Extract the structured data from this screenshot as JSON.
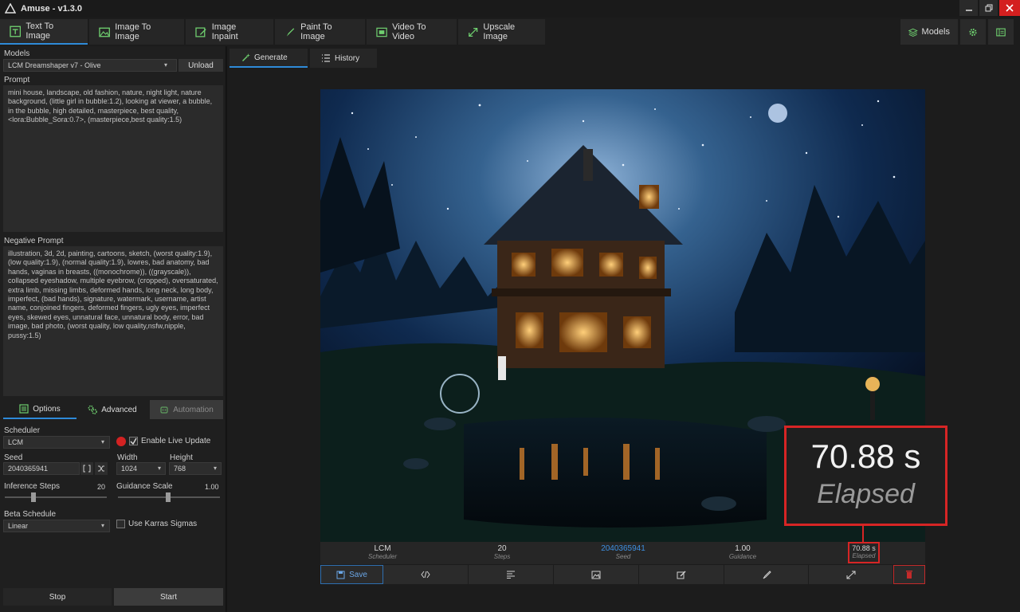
{
  "app": {
    "title": "Amuse - v1.3.0"
  },
  "tabs": [
    {
      "label": "Text To Image",
      "icon": "text-icon",
      "active": true
    },
    {
      "label": "Image To Image",
      "icon": "image-icon"
    },
    {
      "label": "Image Inpaint",
      "icon": "pencil-icon"
    },
    {
      "label": "Paint To Image",
      "icon": "brush-icon"
    },
    {
      "label": "Video To Video",
      "icon": "video-icon"
    },
    {
      "label": "Upscale Image",
      "icon": "expand-icon"
    }
  ],
  "right_tabs": {
    "models_label": "Models"
  },
  "left": {
    "models_label": "Models",
    "model_value": "LCM Dreamshaper v7 - Olive",
    "unload_label": "Unload",
    "prompt_label": "Prompt",
    "prompt_text": "mini house, landscape, old fashion, nature, night light, nature background, (little girl in bubble:1.2), looking at viewer, a bubble, in the bubble, high detailed, masterpiece, best quality, <lora:Bubble_Sora:0.7>, (masterpiece,best quality:1.5)",
    "negative_label": "Negative Prompt",
    "negative_text": "illustration, 3d, 2d, painting, cartoons, sketch, (worst quality:1.9), (low quality:1.9), (normal quality:1.9), lowres, bad anatomy, bad hands, vaginas in breasts, ((monochrome)), ((grayscale)), collapsed eyeshadow, multiple eyebrow, (cropped), oversaturated, extra limb, missing limbs, deformed hands, long neck, long body, imperfect, (bad hands), signature, watermark, username, artist name, conjoined fingers, deformed fingers, ugly eyes, imperfect eyes, skewed eyes, unnatural face, unnatural body, error, bad image, bad photo, (worst quality, low quality,nsfw,nipple, pussy:1.5)",
    "subtabs": {
      "options": "Options",
      "advanced": "Advanced",
      "automation": "Automation"
    },
    "scheduler_label": "Scheduler",
    "scheduler_value": "LCM",
    "live_update_label": "Enable Live Update",
    "live_update_checked": true,
    "seed_label": "Seed",
    "seed_value": "2040365941",
    "width_label": "Width",
    "width_value": "1024",
    "height_label": "Height",
    "height_value": "768",
    "steps_label": "Inference Steps",
    "steps_value": "20",
    "guidance_label": "Guidance Scale",
    "guidance_value": "1.00",
    "beta_label": "Beta Schedule",
    "beta_value": "Linear",
    "karras_label": "Use Karras Sigmas",
    "karras_checked": false,
    "stop_label": "Stop",
    "start_label": "Start"
  },
  "view_tabs": {
    "generate": "Generate",
    "history": "History"
  },
  "stats": {
    "scheduler": {
      "value": "LCM",
      "key": "Scheduler"
    },
    "steps": {
      "value": "20",
      "key": "Steps"
    },
    "seed": {
      "value": "2040365941",
      "key": "Seed"
    },
    "guidance": {
      "value": "1.00",
      "key": "Guidance"
    },
    "elapsed": {
      "value": "70.88 s",
      "key": "Elapsed"
    }
  },
  "actions": {
    "save_label": "Save"
  },
  "callout": {
    "value": "70.88 s",
    "label": "Elapsed"
  },
  "colors": {
    "accent": "#2e8ad8",
    "highlight": "#d62525",
    "seed_text": "#3d8fe0"
  }
}
